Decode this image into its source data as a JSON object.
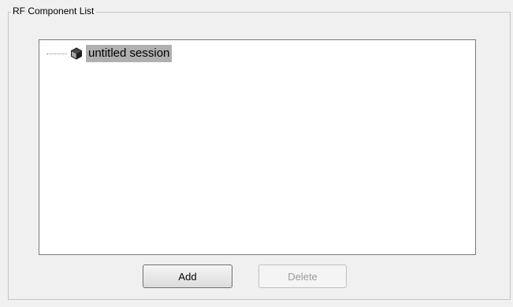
{
  "panel": {
    "title": "RF Component List"
  },
  "tree": {
    "nodes": [
      {
        "label": "untitled session",
        "icon": "cube-icon",
        "selected": true
      }
    ]
  },
  "buttons": {
    "add_label": "Add",
    "delete_label": "Delete",
    "delete_enabled": false
  },
  "colors": {
    "window_bg": "#f0f0f0",
    "selection_bg": "#b0b0b0",
    "disabled_text": "#9a9a9a"
  }
}
